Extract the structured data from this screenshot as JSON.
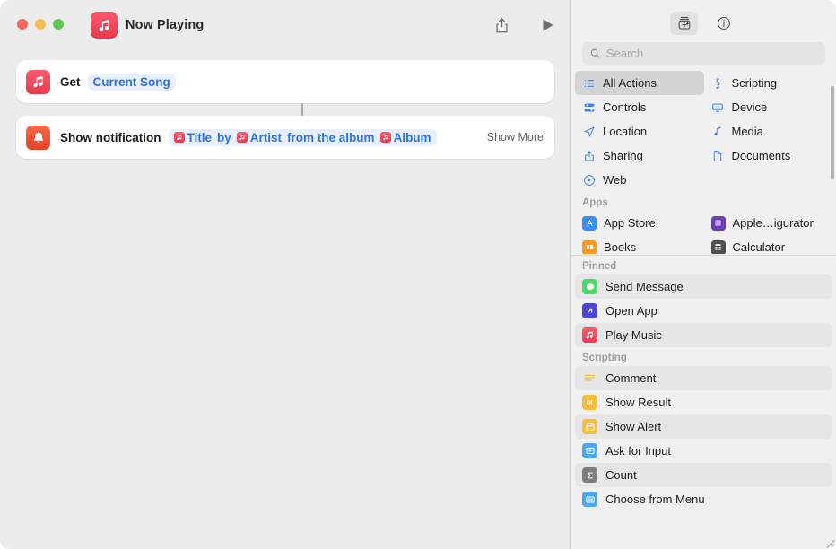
{
  "window": {
    "title": "Now Playing",
    "app_icon": "music-note-icon",
    "traffic_lights": [
      {
        "name": "close",
        "color": "#f2685f"
      },
      {
        "name": "minimize",
        "color": "#f5bd4f"
      },
      {
        "name": "maximize",
        "color": "#61c554"
      }
    ],
    "toolbar_right": [
      {
        "name": "share-icon",
        "label": "Share"
      },
      {
        "name": "play-icon",
        "label": "Run"
      }
    ]
  },
  "editor": {
    "actions": [
      {
        "icon": "music-note-icon",
        "label": "Get",
        "field": [
          {
            "type": "text",
            "text": "Current Song"
          }
        ],
        "show_more": ""
      },
      {
        "icon": "bell-icon",
        "label": "Show notification",
        "field": [
          {
            "type": "token",
            "text": "Title"
          },
          {
            "type": "text",
            "text": "by"
          },
          {
            "type": "token",
            "text": "Artist"
          },
          {
            "type": "text",
            "text": "from the album"
          },
          {
            "type": "token",
            "text": "Album"
          }
        ],
        "show_more": "Show More"
      }
    ]
  },
  "sidebar": {
    "toolbar": [
      {
        "name": "action-library-icon",
        "label": "Action Library",
        "active": true
      },
      {
        "name": "info-icon",
        "label": "Shortcut Details",
        "active": false
      }
    ],
    "search": {
      "placeholder": "Search",
      "value": "",
      "icon": "search-icon"
    },
    "categories": [
      {
        "label": "All Actions",
        "icon": "list-bullet-icon",
        "selected": true
      },
      {
        "label": "Scripting",
        "icon": "scripting-icon",
        "selected": false
      },
      {
        "label": "Controls",
        "icon": "controls-icon",
        "selected": false
      },
      {
        "label": "Device",
        "icon": "display-icon",
        "selected": false
      },
      {
        "label": "Location",
        "icon": "location-arrow-icon",
        "selected": false
      },
      {
        "label": "Media",
        "icon": "music-note-icon",
        "selected": false
      },
      {
        "label": "Sharing",
        "icon": "share-icon",
        "selected": false
      },
      {
        "label": "Documents",
        "icon": "document-icon",
        "selected": false
      },
      {
        "label": "Web",
        "icon": "safari-compass-icon",
        "selected": false
      }
    ],
    "apps_header": "Apps",
    "apps": [
      {
        "label": "App Store",
        "icon": "app-store-icon",
        "color": "#3a8ef6"
      },
      {
        "label": "Apple…igurator",
        "icon": "apple-configurator-icon",
        "color": "#6a3fb5"
      },
      {
        "label": "Books",
        "icon": "books-icon",
        "color": "#f59a23"
      },
      {
        "label": "Calculator",
        "icon": "calculator-icon",
        "color": "#4f4f4f"
      }
    ],
    "pinned_header": "Pinned",
    "pinned": [
      {
        "label": "Send Message",
        "icon": "messages-icon",
        "color": "#4cd964",
        "alt": true
      },
      {
        "label": "Open App",
        "icon": "open-app-icon",
        "color": "#4b45d6",
        "alt": false
      },
      {
        "label": "Play Music",
        "icon": "music-note-icon",
        "color": "#ea384f",
        "alt": true
      }
    ],
    "scripting_header": "Scripting",
    "scripting": [
      {
        "label": "Comment",
        "icon": "comment-lines-icon",
        "color": "#f0f0f0",
        "alt": true
      },
      {
        "label": "Show Result",
        "icon": "show-result-icon",
        "color": "#f5bd3d",
        "alt": false
      },
      {
        "label": "Show Alert",
        "icon": "show-alert-icon",
        "color": "#f5bd3d",
        "alt": true
      },
      {
        "label": "Ask for Input",
        "icon": "ask-input-icon",
        "color": "#4aa8f0",
        "alt": false
      },
      {
        "label": "Count",
        "icon": "sigma-count-icon",
        "color": "#7d7d7d",
        "alt": true
      },
      {
        "label": "Choose from Menu",
        "icon": "choose-menu-icon",
        "color": "#4aa8f0",
        "alt": false
      }
    ]
  },
  "colors": {
    "accent_blue": "#2b72f0",
    "token_red": "#ea384f",
    "sidebar_bg": "#f0f0f0",
    "canvas_bg": "#ececec",
    "card_bg": "#ffffff"
  }
}
